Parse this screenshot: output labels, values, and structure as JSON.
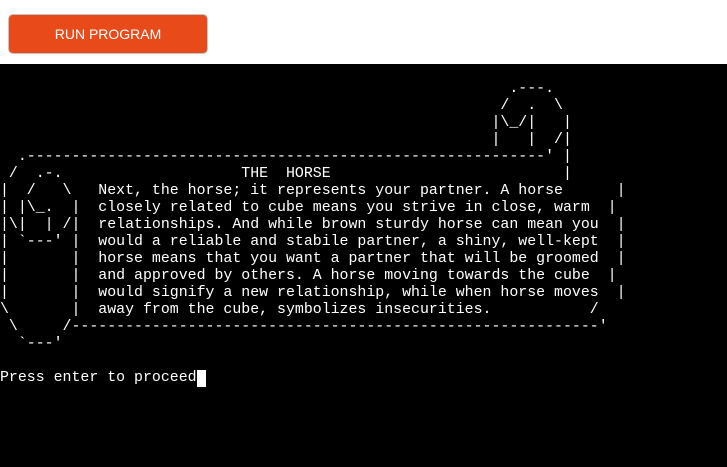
{
  "toolbar": {
    "run_label": "RUN PROGRAM"
  },
  "terminal": {
    "card_art": "                                                         .---.\n                                                        /  .  \\\n                                                       |\\_/|   |\n                                                       |   |  /|\n  .----------------------------------------------------------' |\n /  .-.                    THE  HORSE                          |\n|  /   \\   Next, the horse; it represents your partner. A horse      |\n| |\\_.  |  closely related to cube means you strive in close, warm  |\n|\\|  | /|  relationships. And while brown sturdy horse can mean you  |\n| `---' |  would a reliable and stabile partner, a shiny, well-kept  |\n|       |  horse means that you want a partner that will be groomed  |\n|       |  and approved by others. A horse moving towards the cube  |\n|       |  would signify a new relationship, while when horse moves  |\n\\       |  away from the cube, symbolizes insecurities.           /\n \\     /-----------------------------------------------------------'\n  `---'",
    "prompt": "Press enter to proceed"
  },
  "colors": {
    "button_bg": "#e84a19",
    "terminal_bg": "#000000",
    "terminal_fg": "#ffffff"
  }
}
